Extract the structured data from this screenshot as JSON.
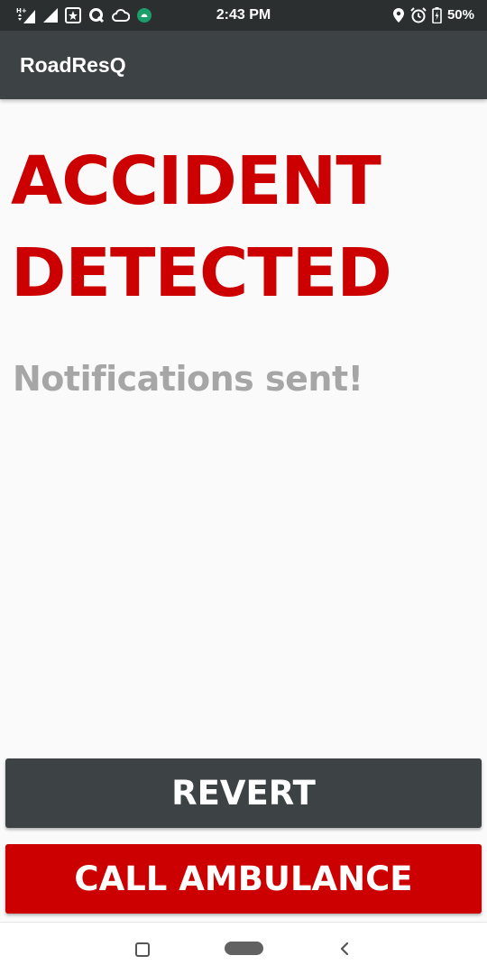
{
  "status_bar": {
    "time": "2:43 PM",
    "battery": "50%",
    "icons_left": [
      "hplus-signal-icon",
      "signal-icon",
      "app-notification-icon",
      "q-app-icon",
      "cloud-icon",
      "android-icon"
    ],
    "icons_right": [
      "location-icon",
      "alarm-icon",
      "battery-charging-icon"
    ]
  },
  "app_bar": {
    "title": "RoadResQ",
    "color": "#3d4244"
  },
  "main": {
    "alert_line1": "ACCIDENT",
    "alert_line2": "DETECTED",
    "alert_color": "#cc0000",
    "status_message": "Notifications sent!"
  },
  "buttons": {
    "revert_label": "REVERT",
    "call_label": "CALL AMBULANCE"
  },
  "nav_bar": {
    "icons": [
      "recents-icon",
      "home-icon",
      "back-icon"
    ]
  }
}
